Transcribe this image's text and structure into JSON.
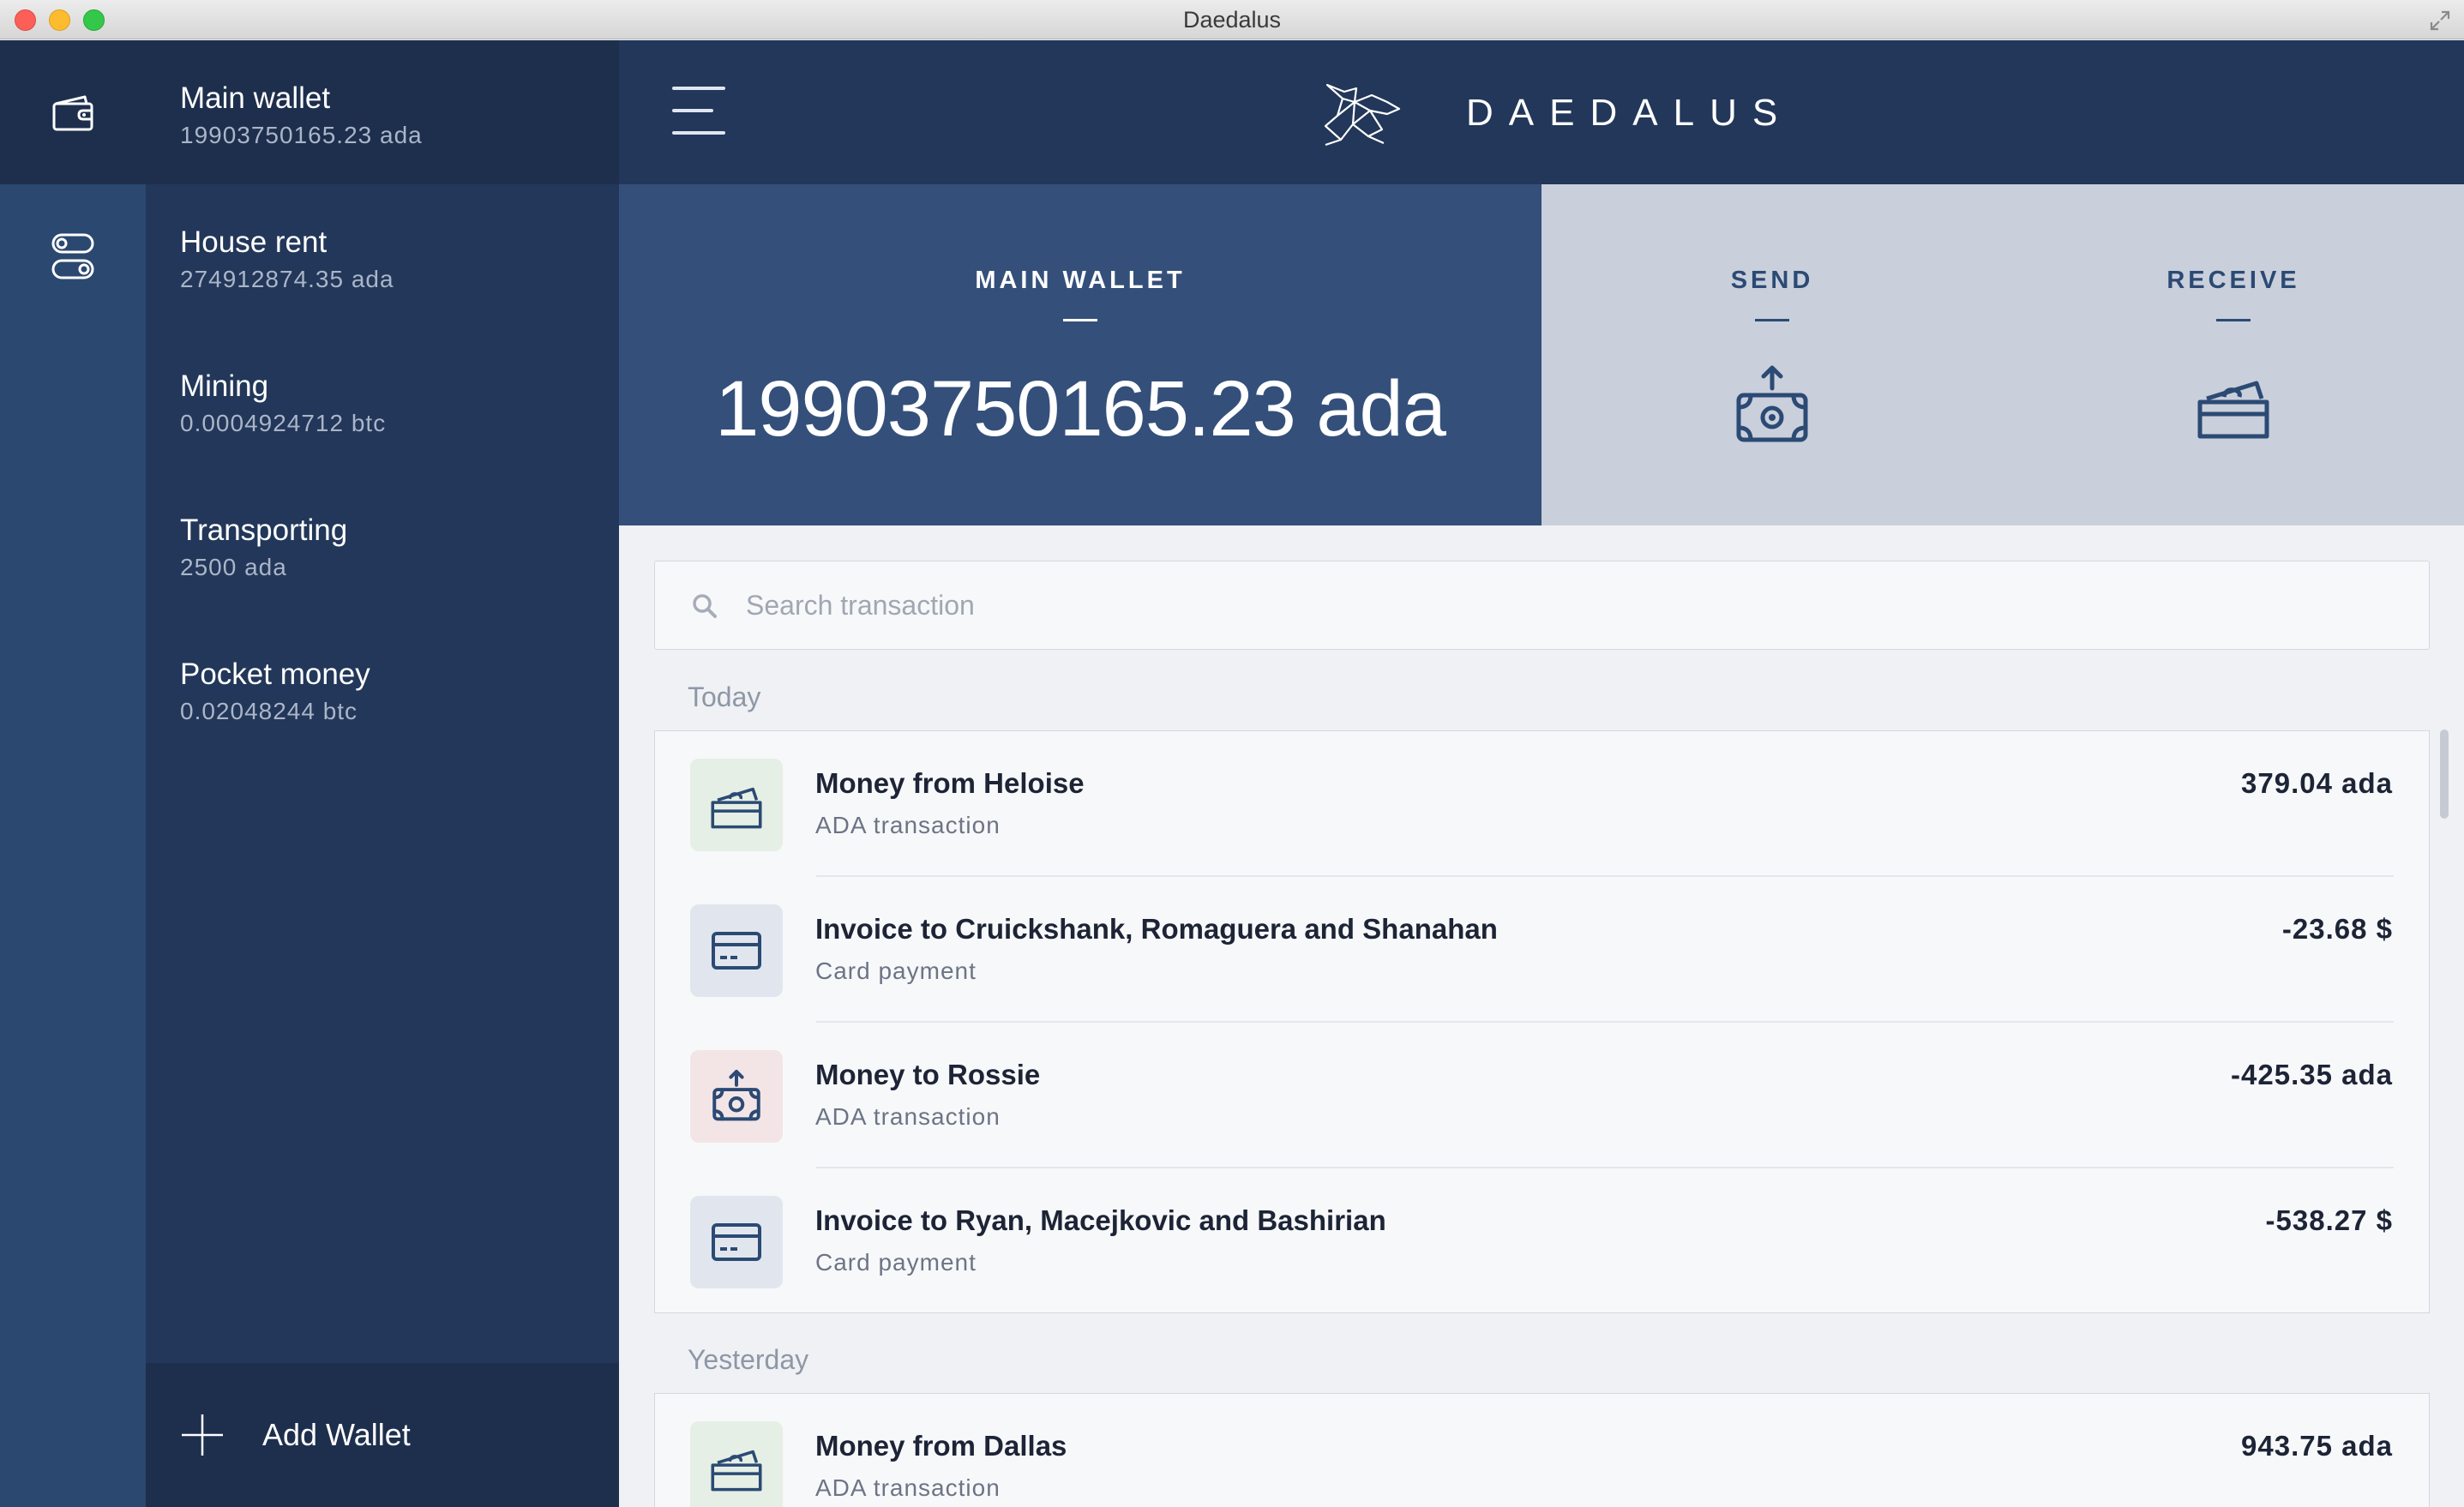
{
  "window": {
    "title": "Daedalus"
  },
  "header": {
    "brand": "DAEDALUS"
  },
  "rail": {
    "items": [
      "wallet-icon",
      "settings-toggle-icon"
    ]
  },
  "wallets": [
    {
      "name": "Main wallet",
      "amount": "19903750165.23 ada",
      "active": true
    },
    {
      "name": "House rent",
      "amount": "274912874.35 ada"
    },
    {
      "name": "Mining",
      "amount": "0.0004924712 btc"
    },
    {
      "name": "Transporting",
      "amount": "2500 ada"
    },
    {
      "name": "Pocket money",
      "amount": "0.02048244 btc"
    }
  ],
  "add_wallet": {
    "label": "Add Wallet"
  },
  "summary": {
    "title": "MAIN WALLET",
    "amount": "19903750165.23 ada"
  },
  "actions": {
    "send": "SEND",
    "receive": "RECEIVE"
  },
  "search": {
    "placeholder": "Search transaction"
  },
  "groups": [
    {
      "label": "Today",
      "transactions": [
        {
          "title": "Money from Heloise",
          "type": "ADA transaction",
          "amount": "379.04 ada",
          "icon": "money-in-icon"
        },
        {
          "title": "Invoice to Cruickshank, Romaguera and Shanahan",
          "type": "Card payment",
          "amount": "-23.68 $",
          "icon": "card-icon"
        },
        {
          "title": "Money to Rossie",
          "type": "ADA transaction",
          "amount": "-425.35 ada",
          "icon": "money-out-icon"
        },
        {
          "title": "Invoice to Ryan, Macejkovic and Bashirian",
          "type": "Card payment",
          "amount": "-538.27 $",
          "icon": "card-icon"
        }
      ]
    },
    {
      "label": "Yesterday",
      "transactions": [
        {
          "title": "Money from Dallas",
          "type": "ADA transaction",
          "amount": "943.75 ada",
          "icon": "money-in-icon"
        }
      ]
    }
  ],
  "colors": {
    "rail": "#2b4870",
    "sidebar": "#223759",
    "active": "#1e2f4d",
    "summary": "#34507a",
    "actions": "#c9cfdb",
    "accent_text": "#2b4a74"
  }
}
